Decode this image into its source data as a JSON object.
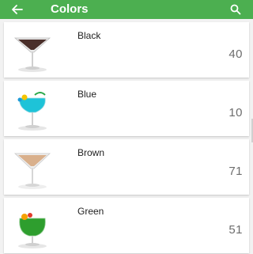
{
  "appbar": {
    "title": "Colors",
    "back_icon": "arrow-left-icon",
    "search_icon": "search-icon",
    "color": "#4caf50"
  },
  "list": {
    "items": [
      {
        "name": "Black",
        "count": "40",
        "drink_color": "#4a2f2a"
      },
      {
        "name": "Blue",
        "count": "10",
        "drink_color": "#1ec3d8"
      },
      {
        "name": "Brown",
        "count": "71",
        "drink_color": "#d9b08c"
      },
      {
        "name": "Green",
        "count": "51",
        "drink_color": "#2e9e2e"
      }
    ]
  }
}
